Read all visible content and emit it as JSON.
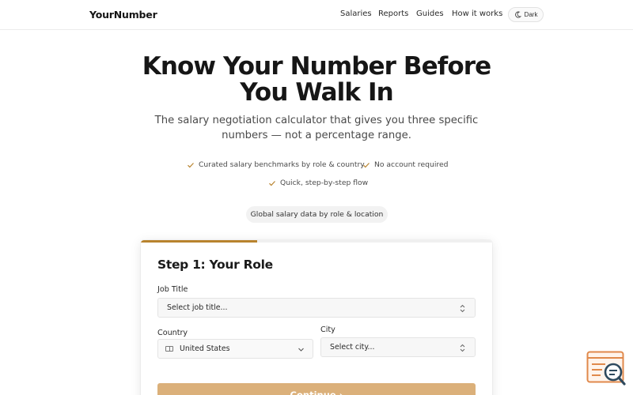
{
  "header": {
    "brand": "YourNumber",
    "nav": [
      "Salaries",
      "Reports",
      "Guides",
      "How it works"
    ],
    "theme_toggle_label": "Dark"
  },
  "hero": {
    "title": "Know Your Number Before You Walk In",
    "subtitle": "The salary negotiation calculator that gives you three specific numbers — not a percentage range.",
    "features": [
      "Curated salary benchmarks by role & country",
      "No account required",
      "Quick, step-by-step flow"
    ],
    "data_pill": "Global salary data by role & location"
  },
  "form": {
    "step_title": "Step 1: Your Role",
    "progress_percent": 33,
    "job_title": {
      "label": "Job Title",
      "value": "Select job title..."
    },
    "country": {
      "label": "Country",
      "value": "United States"
    },
    "city": {
      "label": "City",
      "value": "Select city..."
    },
    "continue_label": "Continue ›"
  },
  "colors": {
    "accent": "#b8832e",
    "button": "#dbb07a",
    "widget": "#e0894b"
  },
  "icons": {
    "theme": "moon-icon",
    "feature": "check-icon",
    "help": "help-search-icon"
  }
}
